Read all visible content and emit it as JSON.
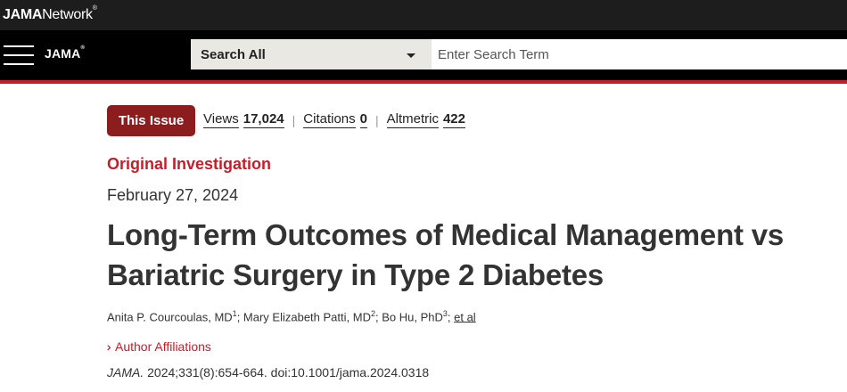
{
  "topbar": {
    "brand_bold": "JAMA",
    "brand_light": "Network",
    "brand_mark": "®"
  },
  "navbar": {
    "logo": "JAMA",
    "logo_mark": "®",
    "menu_icon": "hamburger-menu-icon",
    "search_scope": "Search All",
    "search_placeholder": "Enter Search Term",
    "search_value": ""
  },
  "colors": {
    "accent_red": "#c41e2b",
    "issue_button": "#8b1d1f",
    "navbar_bg": "#000000",
    "topbar_bg": "#1d1d1d"
  },
  "article": {
    "issue_button": "This Issue",
    "metrics": [
      {
        "label": "Views",
        "value": "17,024"
      },
      {
        "label": "Citations",
        "value": "0"
      },
      {
        "label": "Altmetric",
        "value": "422"
      }
    ],
    "type": "Original Investigation",
    "date": "February 27, 2024",
    "title_line1": "Long-Term Outcomes of Medical Management vs",
    "title_line2": "Bariatric Surgery in Type 2 Diabetes",
    "authors": [
      {
        "name": "Anita P. Courcoulas, MD",
        "sup": "1"
      },
      {
        "name": "Mary Elizabeth Patti, MD",
        "sup": "2"
      },
      {
        "name": "Bo Hu, PhD",
        "sup": "3"
      }
    ],
    "et_al": "et al",
    "affiliations_label": "Author Affiliations",
    "affiliations_icon": "double-chevron-right-icon",
    "citation_journal": "JAMA.",
    "citation_rest": " 2024;331(8):654-664. doi:10.1001/jama.2024.0318"
  }
}
